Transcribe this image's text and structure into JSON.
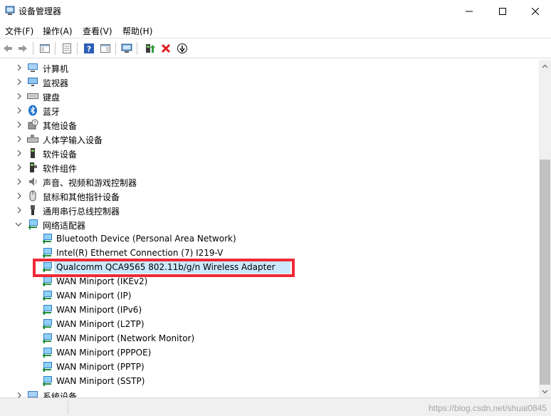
{
  "window": {
    "title": "设备管理器",
    "icons": {
      "app": "device-manager-icon",
      "min": "minimize-icon",
      "max": "maximize-icon",
      "close": "close-icon"
    }
  },
  "menu": {
    "file": "文件(F)",
    "action": "操作(A)",
    "view": "查看(V)",
    "help": "帮助(H)"
  },
  "toolbar": {
    "icons": [
      "back-icon",
      "forward-icon",
      "show-hide-console-tree-icon",
      "properties-icon",
      "help-icon",
      "action-pane-icon",
      "scan-hardware-icon",
      "update-driver-icon",
      "uninstall-icon",
      "disable-device-icon"
    ]
  },
  "tree": {
    "categories": [
      {
        "label": "计算机",
        "icon": "computer-icon"
      },
      {
        "label": "监视器",
        "icon": "monitor-icon"
      },
      {
        "label": "键盘",
        "icon": "keyboard-icon"
      },
      {
        "label": "蓝牙",
        "icon": "bluetooth-icon"
      },
      {
        "label": "其他设备",
        "icon": "other-devices-icon"
      },
      {
        "label": "人体学输入设备",
        "icon": "hid-icon"
      },
      {
        "label": "软件设备",
        "icon": "software-device-icon"
      },
      {
        "label": "软件组件",
        "icon": "software-component-icon"
      },
      {
        "label": "声音、视频和游戏控制器",
        "icon": "speaker-icon"
      },
      {
        "label": "鼠标和其他指针设备",
        "icon": "mouse-icon"
      },
      {
        "label": "通用串行总线控制器",
        "icon": "usb-icon"
      },
      {
        "label": "网络适配器",
        "icon": "network-adapter-icon"
      }
    ],
    "network_adapters": [
      "Bluetooth Device (Personal Area Network)",
      "Intel(R) Ethernet Connection (7) I219-V",
      "Qualcomm QCA9565 802.11b/g/n Wireless Adapter",
      "WAN Miniport (IKEv2)",
      "WAN Miniport (IP)",
      "WAN Miniport (IPv6)",
      "WAN Miniport (L2TP)",
      "WAN Miniport (Network Monitor)",
      "WAN Miniport (PPPOE)",
      "WAN Miniport (PPTP)",
      "WAN Miniport (SSTP)"
    ],
    "selected_adapter_index": 2,
    "next_category": "系统设备"
  },
  "watermark": "https://blog.csdn.net/shuai0845",
  "colors": {
    "selection": "#cce8ff",
    "highlight_box": "#ee2a38",
    "network_icon": "#2f7fc8"
  }
}
